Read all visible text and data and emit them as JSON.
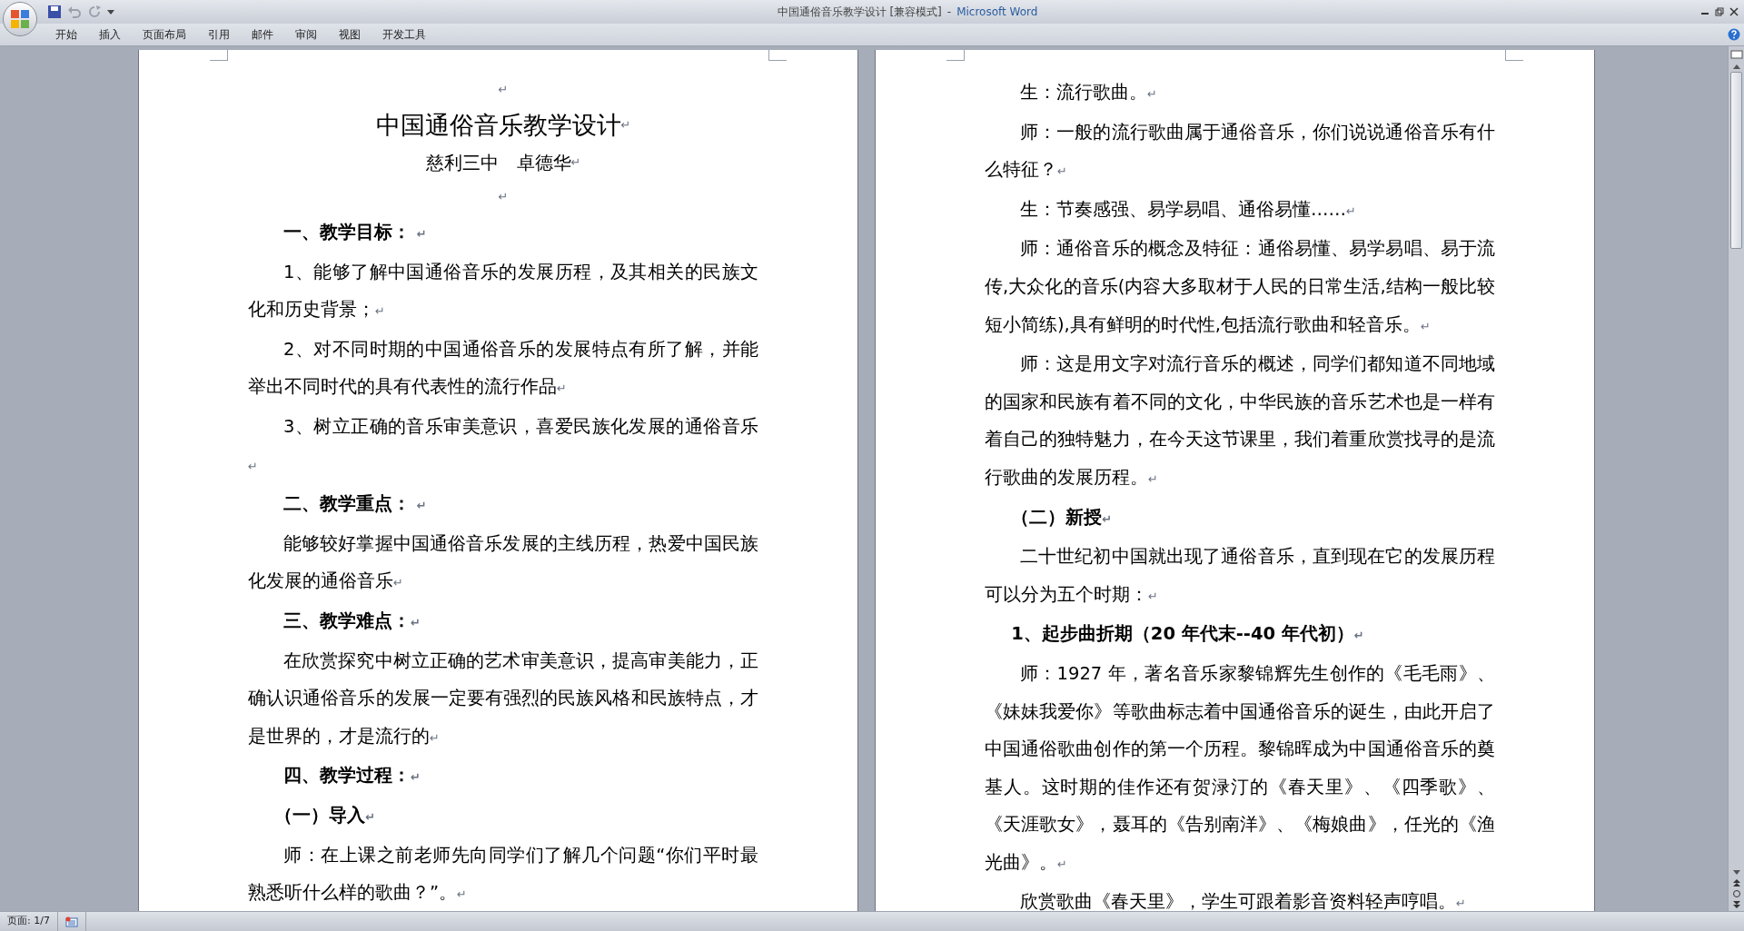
{
  "window": {
    "title": "中国通俗音乐教学设计 [兼容模式]",
    "separator": "-",
    "app": "Microsoft Word"
  },
  "tabs": [
    {
      "label": "开始",
      "selected": false
    },
    {
      "label": "插入",
      "selected": false
    },
    {
      "label": "页面布局",
      "selected": false
    },
    {
      "label": "引用",
      "selected": false
    },
    {
      "label": "邮件",
      "selected": false
    },
    {
      "label": "审阅",
      "selected": false
    },
    {
      "label": "视图",
      "selected": false
    },
    {
      "label": "开发工具",
      "selected": false
    }
  ],
  "paragraph_mark": "↵",
  "pages": [
    {
      "paragraphs": [
        {
          "kind": "empty"
        },
        {
          "kind": "title",
          "text": "中国通俗音乐教学设计"
        },
        {
          "kind": "subtitle",
          "text": "慈利三中　卓德华"
        },
        {
          "kind": "empty"
        },
        {
          "kind": "heading",
          "text": "一、教学目标： "
        },
        {
          "kind": "body",
          "text": "1、能够了解中国通俗音乐的发展历程，及其相关的民族文化和历史背景；"
        },
        {
          "kind": "body",
          "text": "2、对不同时期的中国通俗音乐的发展特点有所了解，并能举出不同时代的具有代表性的流行作品"
        },
        {
          "kind": "body",
          "text": "3、树立正确的音乐审美意识，喜爱民族化发展的通俗音乐"
        },
        {
          "kind": "heading",
          "text": "二、教学重点： "
        },
        {
          "kind": "body",
          "text": "能够较好掌握中国通俗音乐发展的主线历程，热爱中国民族化发展的通俗音乐"
        },
        {
          "kind": "heading",
          "text": "三、教学难点："
        },
        {
          "kind": "body",
          "text": "在欣赏探究中树立正确的艺术审美意识，提高审美能力，正确认识通俗音乐的发展一定要有强烈的民族风格和民族特点，才是世界的，才是流行的"
        },
        {
          "kind": "heading",
          "text": "四、教学过程："
        },
        {
          "kind": "strong",
          "text": "（一）导入"
        },
        {
          "kind": "body",
          "text": "师：在上课之前老师先向同学们了解几个问题“你们平时最熟悉听什么样的歌曲？”。"
        }
      ]
    },
    {
      "paragraphs": [
        {
          "kind": "body",
          "text": "生：流行歌曲。"
        },
        {
          "kind": "body",
          "text": "师：一般的流行歌曲属于通俗音乐，你们说说通俗音乐有什么特征？"
        },
        {
          "kind": "body",
          "text": "生：节奏感强、易学易唱、通俗易懂……"
        },
        {
          "kind": "body",
          "text": "师：通俗音乐的概念及特征：通俗易懂、易学易唱、易于流传,大众化的音乐(内容大多取材于人民的日常生活,结构一般比较短小简练),具有鲜明的时代性,包括流行歌曲和轻音乐。"
        },
        {
          "kind": "body",
          "text": "师：这是用文字对流行音乐的概述，同学们都知道不同地域的国家和民族有着不同的文化，中华民族的音乐艺术也是一样有着自己的独特魅力，在今天这节课里，我们着重欣赏找寻的是流行歌曲的发展历程。"
        },
        {
          "kind": "strong",
          "text": "（二）新授"
        },
        {
          "kind": "body",
          "text": "二十世纪初中国就出现了通俗音乐，直到现在它的发展历程可以分为五个时期："
        },
        {
          "kind": "strong",
          "text": "1、起步曲折期（20 年代末--40 年代初）"
        },
        {
          "kind": "body",
          "text": "师：1927 年，著名音乐家黎锦辉先生创作的《毛毛雨》、《妹妹我爱你》等歌曲标志着中国通俗音乐的诞生，由此开启了中国通俗歌曲创作的第一个历程。黎锦晖成为中国通俗音乐的奠基人。这时期的佳作还有贺渌汀的《春天里》、《四季歌》、《天涯歌女》，聂耳的《告别南洋》、《梅娘曲》，任光的《渔光曲》。"
        },
        {
          "kind": "body",
          "text": "欣赏歌曲《春天里》，学生可跟着影音资料轻声哼唱。"
        }
      ]
    }
  ],
  "status_bar": {
    "page": "页面: 1/7"
  }
}
